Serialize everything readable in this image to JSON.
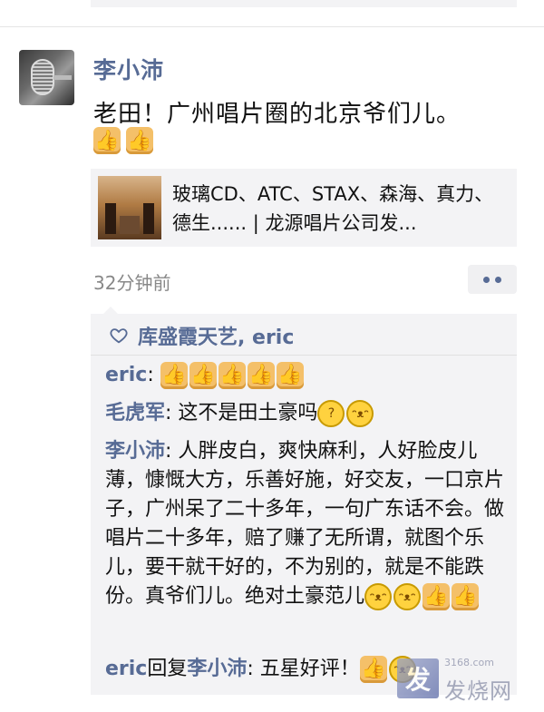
{
  "post": {
    "author": "李小沛",
    "text": "老田！广州唱片圈的北京爷们儿。",
    "emojis": [
      "thumbs-up",
      "thumbs-up"
    ],
    "link": {
      "title": "玻璃CD、ATC、STAX、森海、真力、德生...... | 龙源唱片公司发..."
    },
    "time": "32分钟前"
  },
  "likes": {
    "names": "库盛霞天艺, eric"
  },
  "comments": [
    {
      "name": "eric",
      "sep": ": ",
      "text": "",
      "emojis": [
        "thumbs-up",
        "thumbs-up",
        "thumbs-up",
        "thumbs-up",
        "thumbs-up"
      ]
    },
    {
      "name": "毛虎军",
      "sep": ": ",
      "text": "这不是田土豪吗",
      "emojis": [
        "thinking",
        "grin"
      ]
    },
    {
      "name": "李小沛",
      "sep": ": ",
      "text": "人胖皮白，爽快麻利，人好脸皮儿薄，慷慨大方，乐善好施，好交友，一口京片子，广州呆了二十多年，一句广东话不会。做唱片二十多年，赔了赚了无所谓，就图个乐儿，要干就干好的，不为别的，就是不能跌份。真爷们儿。绝对土豪范儿",
      "emojis": [
        "grin",
        "grin",
        "thumbs-up",
        "thumbs-up"
      ]
    },
    {
      "name": "eric",
      "reply_word": "回复",
      "reply_to": "李小沛",
      "sep": ": ",
      "text": "五星好评！",
      "emojis": [
        "thumbs-up",
        "grin"
      ]
    }
  ],
  "watermark": {
    "logo": "发",
    "text": "发烧网",
    "url": "3168.com"
  },
  "colors": {
    "link_blue": "#576b95",
    "card_bg": "#f3f3f5",
    "time_gray": "#888888"
  }
}
